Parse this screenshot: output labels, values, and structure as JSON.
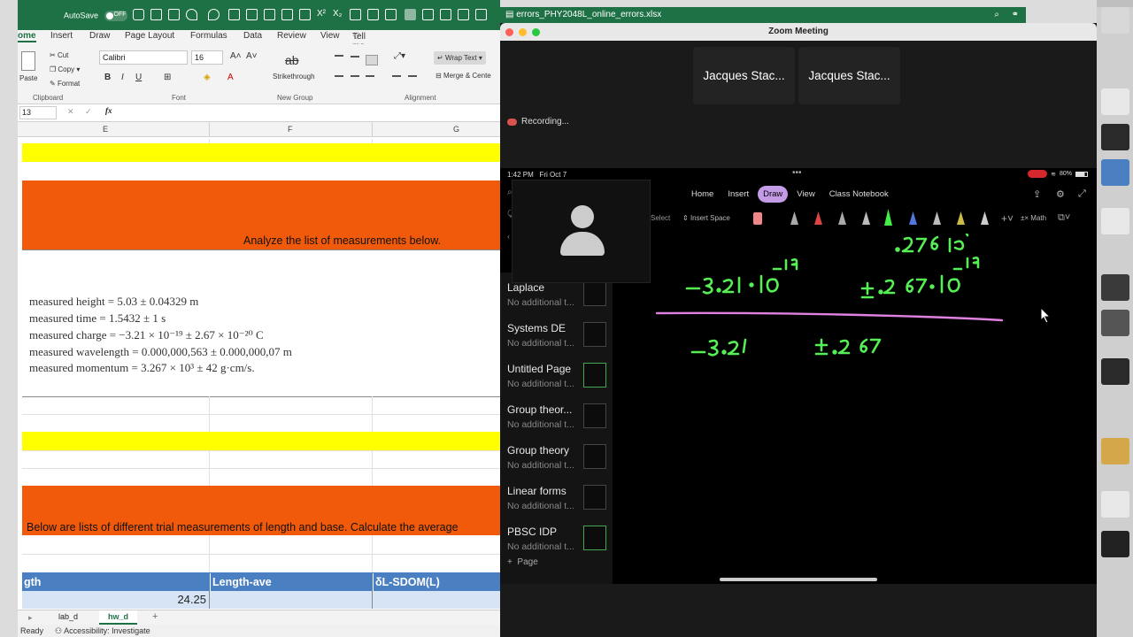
{
  "excel": {
    "autosave_label": "AutoSave",
    "autosave_state": "OFF",
    "filename": "errors_PHY2048L_online_errors.xlsx",
    "tabs": [
      "ome",
      "Insert",
      "Draw",
      "Page Layout",
      "Formulas",
      "Data",
      "Review",
      "View"
    ],
    "tell_me": "Tell me",
    "ribbon": {
      "paste": "Paste",
      "cut": "Cut",
      "copy": "Copy",
      "format": "Format",
      "font_name": "Calibri",
      "font_size": "16",
      "strikethrough": "Strikethrough",
      "wrap_text": "Wrap Text",
      "merge_center": "Merge & Cente",
      "groups": {
        "clipboard": "Clipboard",
        "font": "Font",
        "new_group": "New Group",
        "alignment": "Alignment"
      }
    },
    "name_box": "13",
    "fx": "fx",
    "columns": [
      "E",
      "F",
      "G"
    ],
    "orange_text_1": "Analyze the list of measurements below.",
    "measurements": [
      "measured height  =  5.03 ± 0.04329 m",
      "measured time  =  1.5432 ± 1 s",
      "measured charge  =  −3.21 × 10⁻¹⁹ ± 2.67 × 10⁻²⁰ C",
      "measured wavelength  =  0.000,000,563 ± 0.000,000,07 m",
      "measured momentum  =  3.267 × 10³ ± 42 g·cm/s."
    ],
    "orange_text_2": "Below are lists of different trial measurements of length and base. Calculate the average",
    "table_header": [
      "gth",
      "Length-ave",
      "δL-SDOM(L)"
    ],
    "table_value": "24.25",
    "sheet_tabs": [
      "lab_d",
      "hw_d"
    ],
    "add_sheet": "+",
    "status_ready": "Ready",
    "status_accessibility": "Accessibility: Investigate",
    "colors": {
      "green": "#1e7145",
      "yellow": "#ffff00",
      "orange": "#f05a0a",
      "blue_header": "#4a7fc1",
      "light_blue": "#d6e4f5"
    }
  },
  "zoom": {
    "title": "Zoom Meeting",
    "participants": [
      "Jacques Stac...",
      "Jacques Stac..."
    ],
    "recording": "Recording...",
    "ipad": {
      "time": "1:42 PM",
      "date": "Fri Oct 7",
      "battery": "80%",
      "tabs": [
        "Home",
        "Insert",
        "Draw",
        "View",
        "Class Notebook"
      ],
      "active_tab": "Draw",
      "select": "Select",
      "insert_space": "Insert Space",
      "math": "Math",
      "pages": [
        {
          "title": "Laplace",
          "sub": "No additional t..."
        },
        {
          "title": "Systems DE",
          "sub": "No additional t..."
        },
        {
          "title": "Untitled Page",
          "sub": "No additional t..."
        },
        {
          "title": "Group theor...",
          "sub": "No additional t..."
        },
        {
          "title": "Group theory",
          "sub": "No additional t..."
        },
        {
          "title": "Linear forms",
          "sub": "No additional t..."
        },
        {
          "title": "PBSC IDP",
          "sub": "No additional t..."
        }
      ],
      "add_page": "Page",
      "ink_color": "#55ee55",
      "divider_color": "#e080e0"
    }
  }
}
